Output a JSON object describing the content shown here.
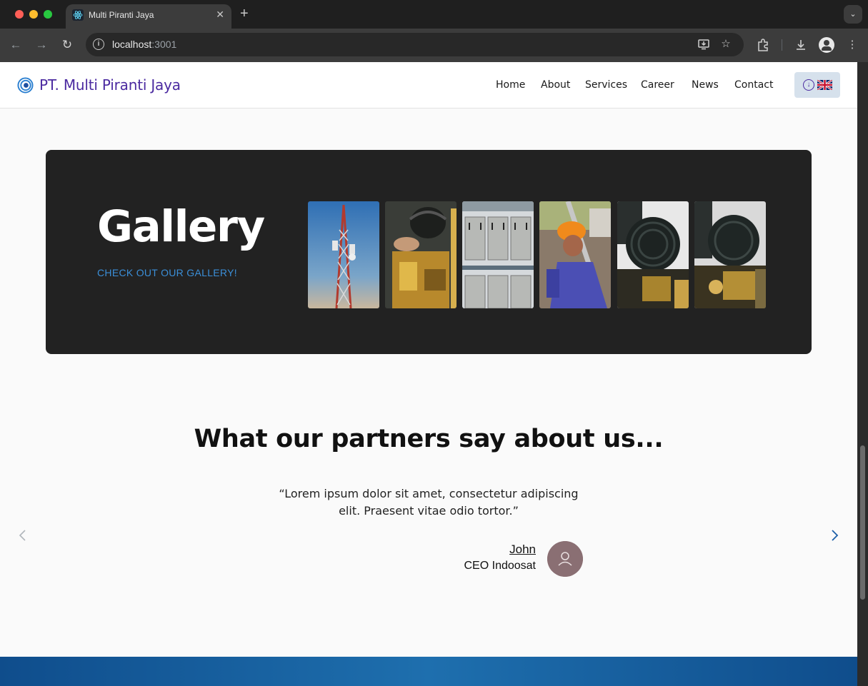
{
  "browser": {
    "tab_title": "Multi Piranti Jaya",
    "new_tab_symbol": "+",
    "close_symbol": "✕",
    "url_host": "localhost",
    "url_port": ":3001"
  },
  "site": {
    "brand": "PT. Multi Piranti Jaya",
    "nav": [
      "Home",
      "About",
      "Services",
      "Career",
      "News",
      "Contact"
    ],
    "language_icon": "download-circle-icon",
    "language_flag": "uk-flag-icon"
  },
  "gallery": {
    "title": "Gallery",
    "link": "CHECK OUT OUR GALLERY!",
    "images": [
      "telecom-tower",
      "generator-engine",
      "battery-rack",
      "worker-on-tower",
      "generator-engine-dark",
      "generator-engine-detail"
    ]
  },
  "testimonials": {
    "heading": "What our partners say about us...",
    "quote_line1": "“Lorem ipsum dolor sit amet, consectetur adipiscing",
    "quote_line2": "elit. Praesent vitae odio tortor.”",
    "author_name": "John",
    "author_role": "CEO Indoosat",
    "prev_icon": "chevron-left-icon",
    "next_icon": "chevron-right-icon"
  },
  "colors": {
    "brand": "#4b2aa0",
    "accent": "#3b8fd8",
    "gallery_bg": "#222222",
    "footer": "#1e6fae"
  }
}
